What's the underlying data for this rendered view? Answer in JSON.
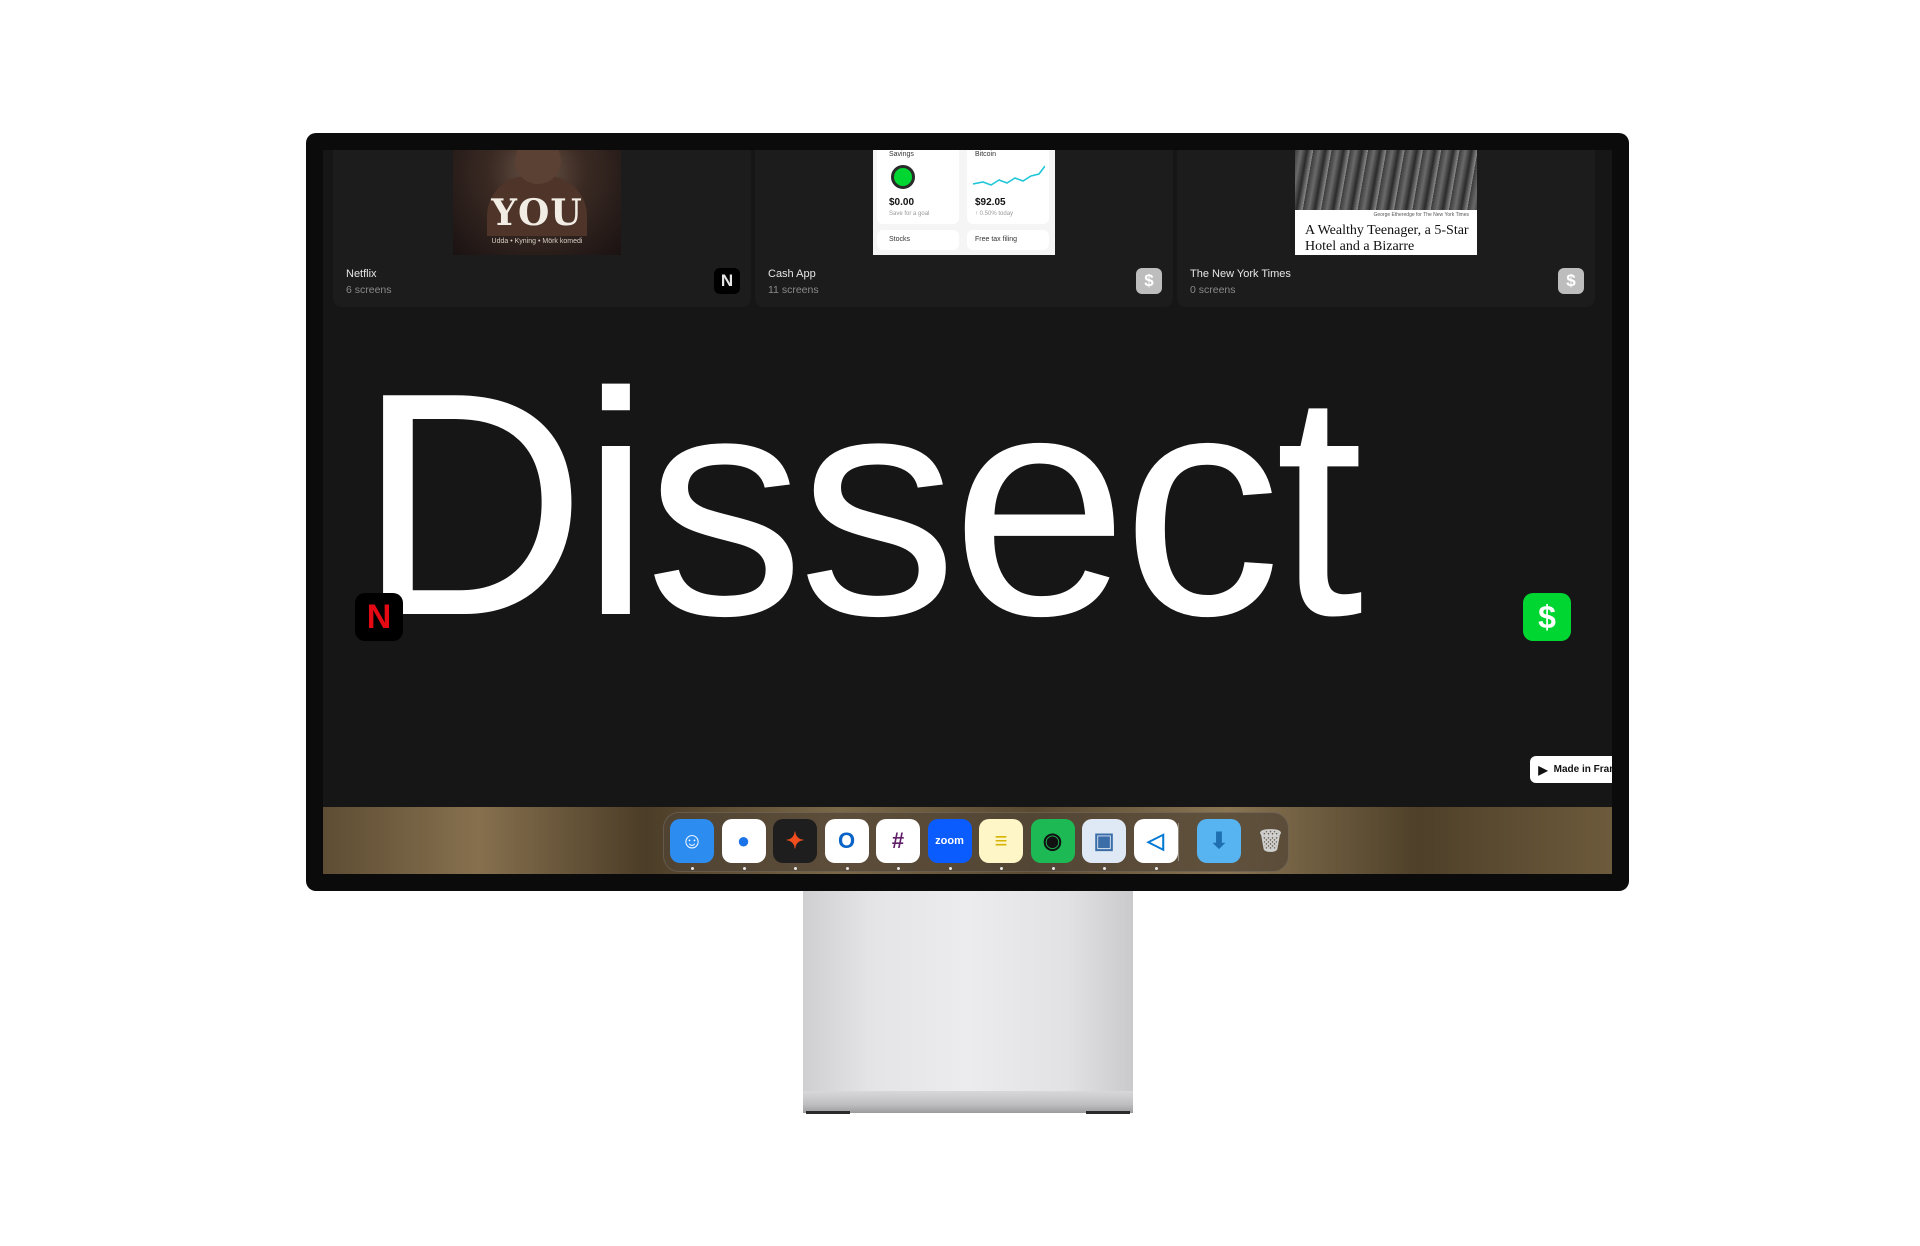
{
  "cards": [
    {
      "title": "Netflix",
      "subtitle": "6 screens",
      "badge_icon": "netflix-n-icon",
      "badge_text": "N"
    },
    {
      "title": "Cash App",
      "subtitle": "11 screens",
      "badge_icon": "cash-app-dollar-icon",
      "badge_text": "$"
    },
    {
      "title": "The New York Times",
      "subtitle": "0 screens",
      "badge_icon": "dollar-icon",
      "badge_text": "$"
    }
  ],
  "netflix_thumb": {
    "title": "YOU",
    "tagline": "Udda • Kyning • Mörk komedi"
  },
  "cash_thumb": {
    "savings_label": "Savings",
    "savings_value": "$0.00",
    "savings_sub": "Save for a goal",
    "bitcoin_label": "Bitcoin",
    "bitcoin_value": "$92.05",
    "bitcoin_sub": "↑ 0.50% today",
    "stocks_label": "Stocks",
    "tax_label": "Free tax filing"
  },
  "nyt_thumb": {
    "caption": "George Etheredge for The New York Times",
    "headline": "A Wealthy Teenager, a 5-Star Hotel and a Bizarre"
  },
  "hero": {
    "title": "Dissect"
  },
  "floating_icons": {
    "netflix": "N",
    "cash": "$"
  },
  "framer_badge": {
    "label": "Made in Framer"
  },
  "dock": {
    "apps": [
      {
        "name": "finder-icon",
        "glyph": "☺",
        "bg": "#2c8cf0",
        "fg": "#ffffff"
      },
      {
        "name": "chrome-icon",
        "glyph": "●",
        "bg": "#ffffff",
        "fg": "#1a73e8"
      },
      {
        "name": "figma-icon",
        "glyph": "✦",
        "bg": "#1e1e1e",
        "fg": "#f24e1e"
      },
      {
        "name": "outlook-icon",
        "glyph": "O",
        "bg": "#ffffff",
        "fg": "#0a64c8"
      },
      {
        "name": "slack-icon",
        "glyph": "#",
        "bg": "#ffffff",
        "fg": "#611f69"
      },
      {
        "name": "zoom-icon",
        "glyph": "zoom",
        "bg": "#0b5cff",
        "fg": "#ffffff"
      },
      {
        "name": "notes-icon",
        "glyph": "≡",
        "bg": "#fff6c7",
        "fg": "#d6b400"
      },
      {
        "name": "spotify-icon",
        "glyph": "◉",
        "bg": "#1db954",
        "fg": "#111111"
      },
      {
        "name": "preview-icon",
        "glyph": "▣",
        "bg": "#dfe9f5",
        "fg": "#3b6ea8"
      },
      {
        "name": "vscode-icon",
        "glyph": "◁",
        "bg": "#ffffff",
        "fg": "#0078d4"
      },
      {
        "name": "downloads-folder-icon",
        "glyph": "⬇",
        "bg": "#58b4f0",
        "fg": "#1e6fb0"
      },
      {
        "name": "trash-icon",
        "glyph": "🗑",
        "bg": "transparent",
        "fg": "#cfcfcf"
      }
    ]
  }
}
